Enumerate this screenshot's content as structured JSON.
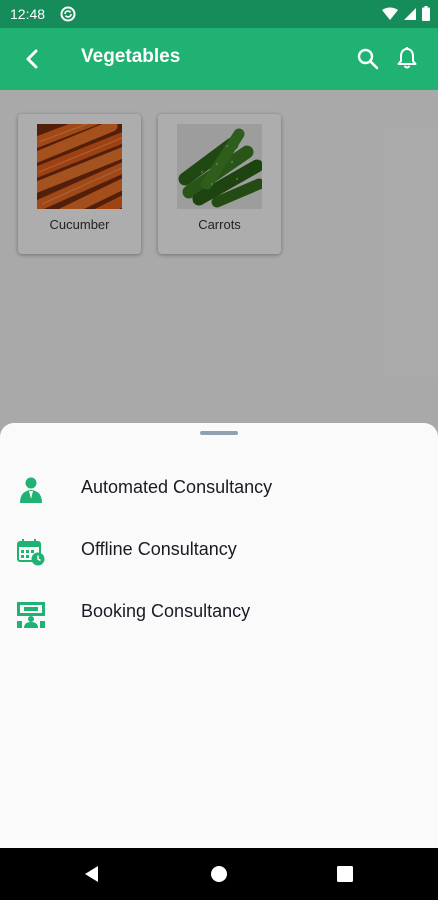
{
  "status": {
    "time": "12:48",
    "icons": [
      "sync-icon",
      "wifi-icon",
      "signal-icon",
      "battery-icon"
    ]
  },
  "appbar": {
    "title": "Vegetables",
    "icons": [
      "back-arrow-icon",
      "search-icon",
      "bell-icon"
    ]
  },
  "cards": [
    {
      "label": "Cucumber",
      "image": "carrots-photo"
    },
    {
      "label": "Carrots",
      "image": "cucumbers-photo"
    }
  ],
  "sheet": {
    "options": [
      {
        "label": "Automated Consultancy",
        "icon": "agent-person-icon"
      },
      {
        "label": "Offline Consultancy",
        "icon": "calendar-clock-icon"
      },
      {
        "label": "Booking Consultancy",
        "icon": "presentation-booking-icon"
      }
    ]
  },
  "navbar": {
    "icons": [
      "nav-back-icon",
      "nav-home-icon",
      "nav-recents-icon"
    ]
  },
  "colors": {
    "primary": "#1fb273",
    "status_bar": "#178c5b",
    "icon_green": "#1fb273"
  }
}
